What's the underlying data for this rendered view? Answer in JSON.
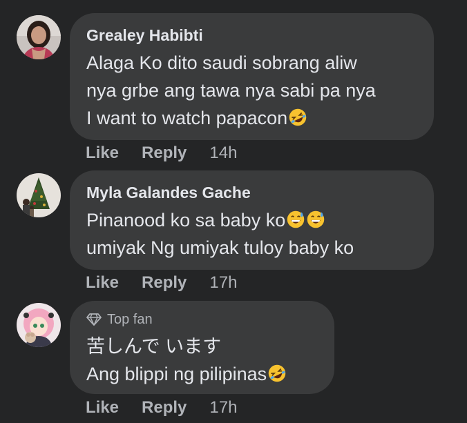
{
  "comments": [
    {
      "author": "Grealey Habibti",
      "badge": "",
      "lines": [
        "Alaga Ko dito saudi sobrang aliw",
        "nya grbe ang tawa nya sabi pa nya",
        "I want to watch papacon"
      ],
      "line_emojis": [
        [],
        [],
        [
          "rolling-on-floor-laughing-emoji"
        ]
      ],
      "like_label": "Like",
      "reply_label": "Reply",
      "time": "14h",
      "avatar_icon": "profile-photo-woman"
    },
    {
      "author": "Myla Galandes Gache",
      "badge": "",
      "lines": [
        "Pinanood ko sa baby ko",
        "umiyak Ng umiyak tuloy baby ko"
      ],
      "line_emojis": [
        [
          "grinning-face-with-sweat-emoji",
          "grinning-face-with-sweat-emoji"
        ],
        []
      ],
      "like_label": "Like",
      "reply_label": "Reply",
      "time": "17h",
      "avatar_icon": "profile-photo-christmas-tree"
    },
    {
      "author": "",
      "badge": "Top fan",
      "badge_icon": "diamond-icon",
      "lines": [
        "苦しんで います",
        "Ang blippi ng pilipinas"
      ],
      "line_emojis": [
        [],
        [
          "rolling-on-floor-laughing-emoji"
        ]
      ],
      "like_label": "Like",
      "reply_label": "Reply",
      "time": "17h",
      "avatar_icon": "profile-photo-anime-girl"
    }
  ],
  "colors": {
    "background": "#242526",
    "bubble": "#3a3b3c",
    "primary_text": "#e4e6eb",
    "secondary_text": "#b0b3b8"
  }
}
